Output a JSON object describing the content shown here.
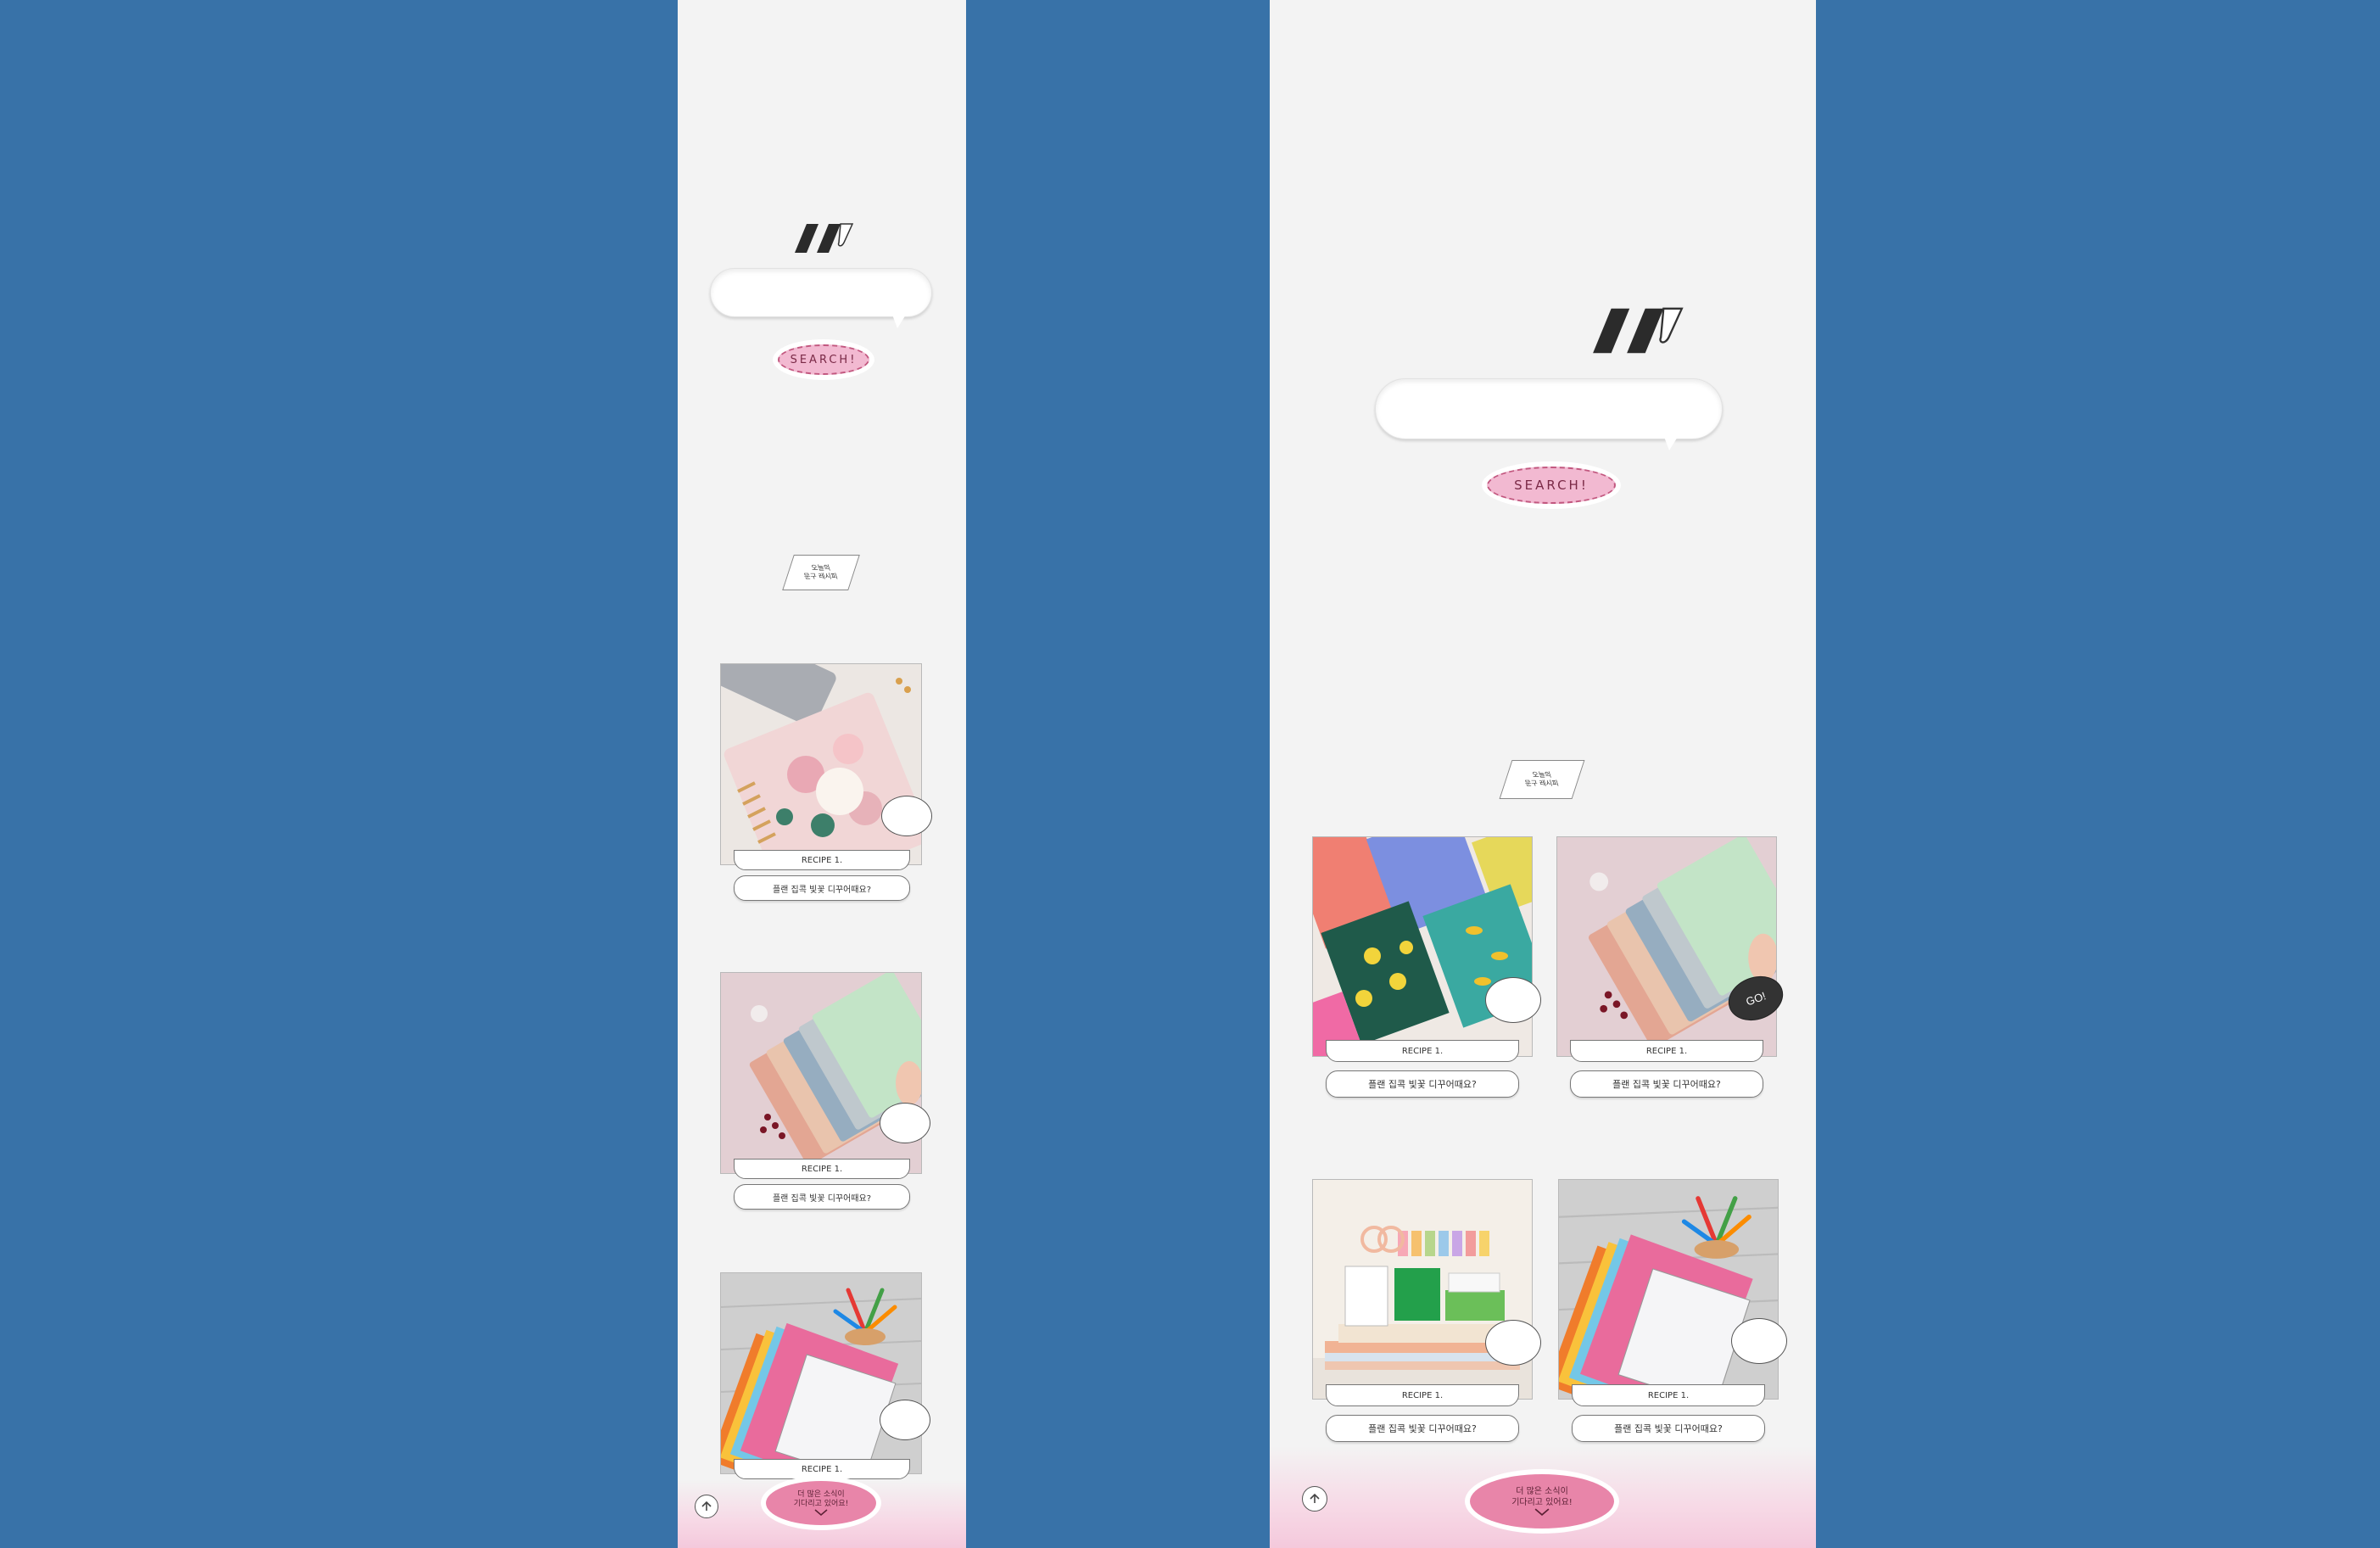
{
  "search": {
    "button_label": "SEARCH!",
    "placeholder": ""
  },
  "section_note": {
    "line1": "오늘의",
    "line2": "문구 레시피"
  },
  "cards": [
    {
      "title": "RECIPE 1.",
      "desc": "플랜 집콕 빛꽃 디꾸어때요?"
    },
    {
      "title": "RECIPE 1.",
      "desc": "플랜 집콕 빛꽃 디꾸어때요?"
    },
    {
      "title": "RECIPE 1.",
      "desc": "플랜 집콕 빛꽃 디꾸어때요?"
    },
    {
      "title": "RECIPE 1.",
      "desc": "플랜 집콕 빛꽃 디꾸어때요?"
    }
  ],
  "go_badge": "GO!",
  "more_button": {
    "line1": "더 많은 소식이",
    "line2": "기다리고 있어요!"
  },
  "colors": {
    "background": "#3872a8",
    "panel": "#f3f3f3",
    "accent_pink": "#e885a9",
    "search_pink": "#f2b9d1"
  },
  "icons": {
    "top": "arrow-up-icon",
    "more": "chevron-down-icon"
  }
}
